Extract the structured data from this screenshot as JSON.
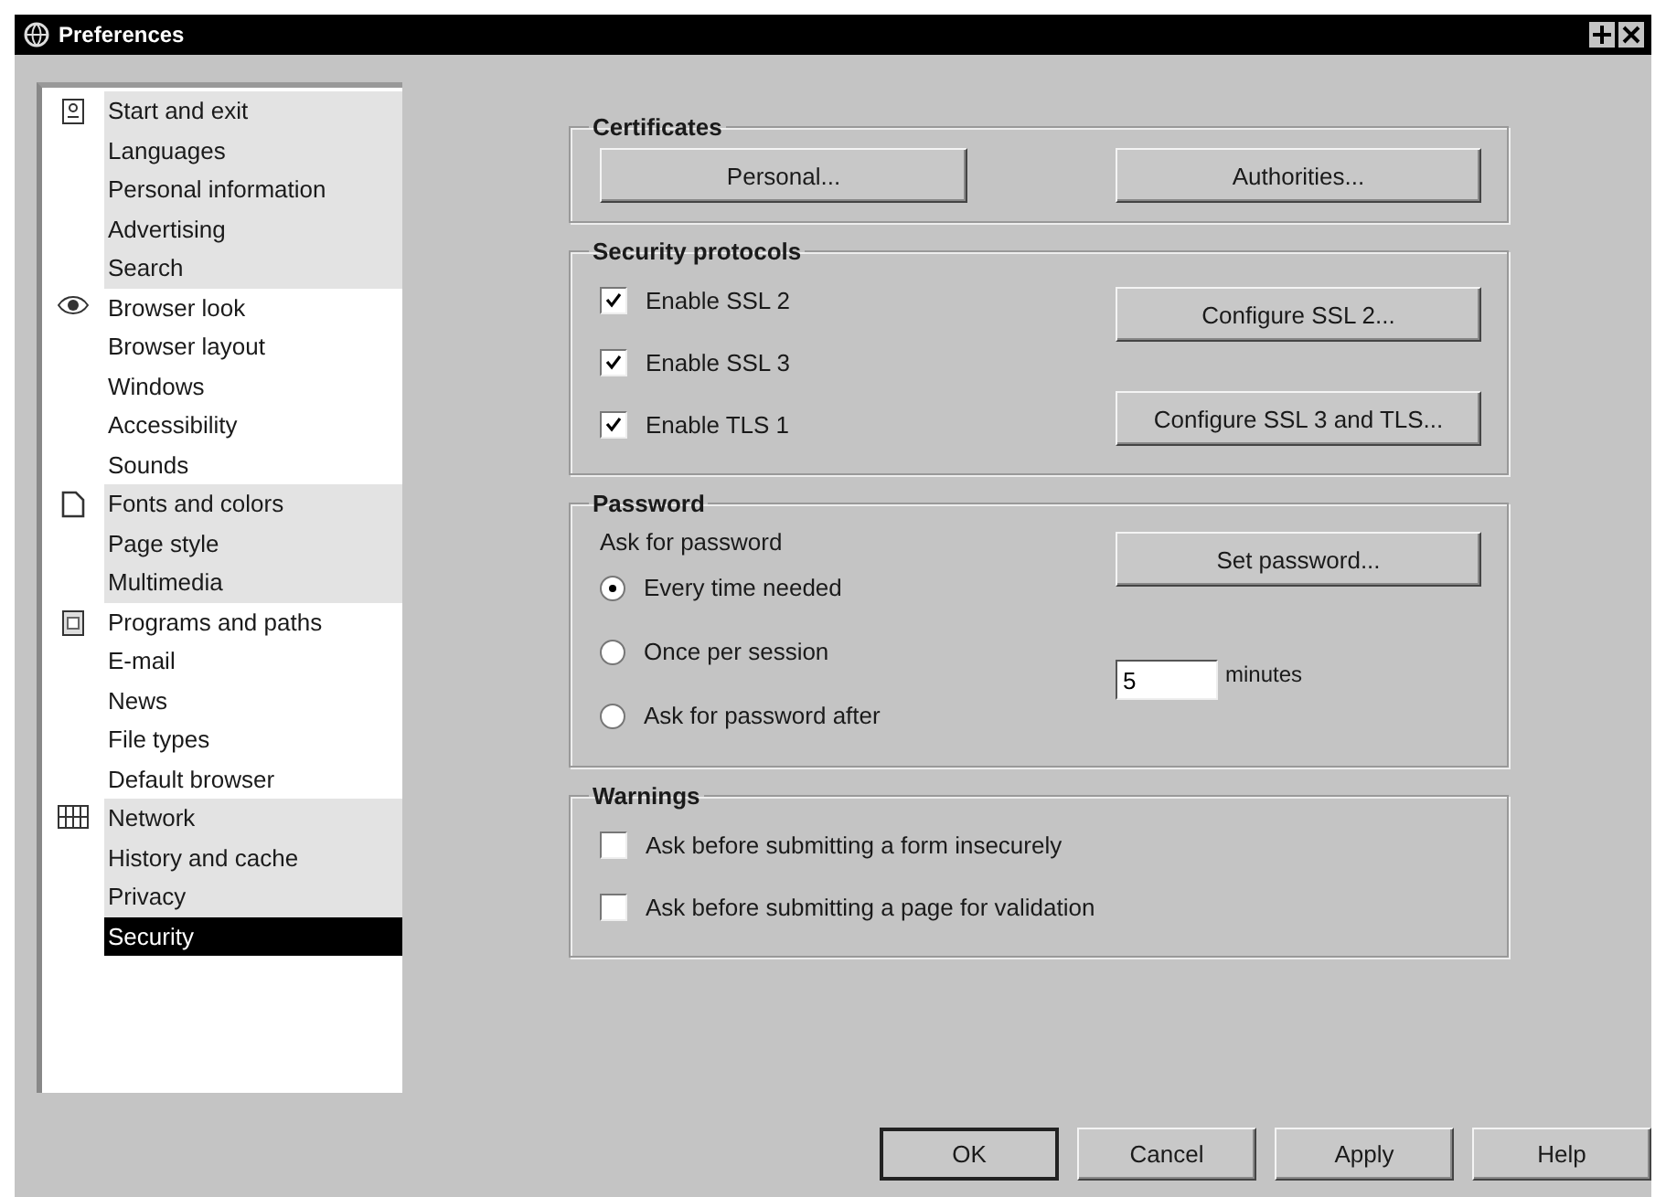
{
  "window": {
    "title": "Preferences"
  },
  "sidebar": {
    "groups": [
      {
        "items": [
          {
            "label": "Start and exit",
            "selected": false
          },
          {
            "label": "Languages",
            "selected": false
          },
          {
            "label": "Personal information",
            "selected": false
          },
          {
            "label": "Advertising",
            "selected": false
          },
          {
            "label": "Search",
            "selected": false
          }
        ]
      },
      {
        "items": [
          {
            "label": "Browser look",
            "selected": false
          },
          {
            "label": "Browser layout",
            "selected": false
          },
          {
            "label": "Windows",
            "selected": false
          },
          {
            "label": "Accessibility",
            "selected": false
          },
          {
            "label": "Sounds",
            "selected": false
          }
        ]
      },
      {
        "items": [
          {
            "label": "Fonts and colors",
            "selected": false
          },
          {
            "label": "Page style",
            "selected": false
          },
          {
            "label": "Multimedia",
            "selected": false
          }
        ]
      },
      {
        "items": [
          {
            "label": "Programs and paths",
            "selected": false
          },
          {
            "label": "E-mail",
            "selected": false
          },
          {
            "label": "News",
            "selected": false
          },
          {
            "label": "File types",
            "selected": false
          },
          {
            "label": "Default browser",
            "selected": false
          }
        ]
      },
      {
        "items": [
          {
            "label": "Network",
            "selected": false
          },
          {
            "label": "History and cache",
            "selected": false
          },
          {
            "label": "Privacy",
            "selected": false
          },
          {
            "label": "Security",
            "selected": true
          }
        ]
      }
    ]
  },
  "certificates": {
    "title": "Certificates",
    "buttons": [
      "Personal...",
      "Authorities..."
    ]
  },
  "security_protocols": {
    "title": "Security protocols",
    "options": [
      {
        "label": "Enable SSL 2",
        "checked": true
      },
      {
        "label": "Enable SSL 3",
        "checked": true
      },
      {
        "label": "Enable TLS 1",
        "checked": true
      }
    ],
    "buttons": [
      "Configure SSL 2...",
      "Configure SSL 3 and TLS..."
    ]
  },
  "password": {
    "title": "Password",
    "prompt": "Ask for password",
    "set_button": "Set password...",
    "options": [
      {
        "label": "Every time needed",
        "selected": true
      },
      {
        "label": "Once per session",
        "selected": false
      },
      {
        "label": "Ask for password after",
        "selected": false
      }
    ],
    "minutes_field": {
      "value": "5"
    },
    "minutes_label": "minutes"
  },
  "warnings": {
    "title": "Warnings",
    "options": [
      {
        "label": "Ask before submitting a form insecurely",
        "checked": false
      },
      {
        "label": "Ask before submitting a page for validation",
        "checked": false
      }
    ]
  },
  "footer_buttons": [
    {
      "label": "OK",
      "default": true
    },
    {
      "label": "Cancel",
      "default": false
    },
    {
      "label": "Apply",
      "default": false
    },
    {
      "label": "Help",
      "default": false
    }
  ]
}
